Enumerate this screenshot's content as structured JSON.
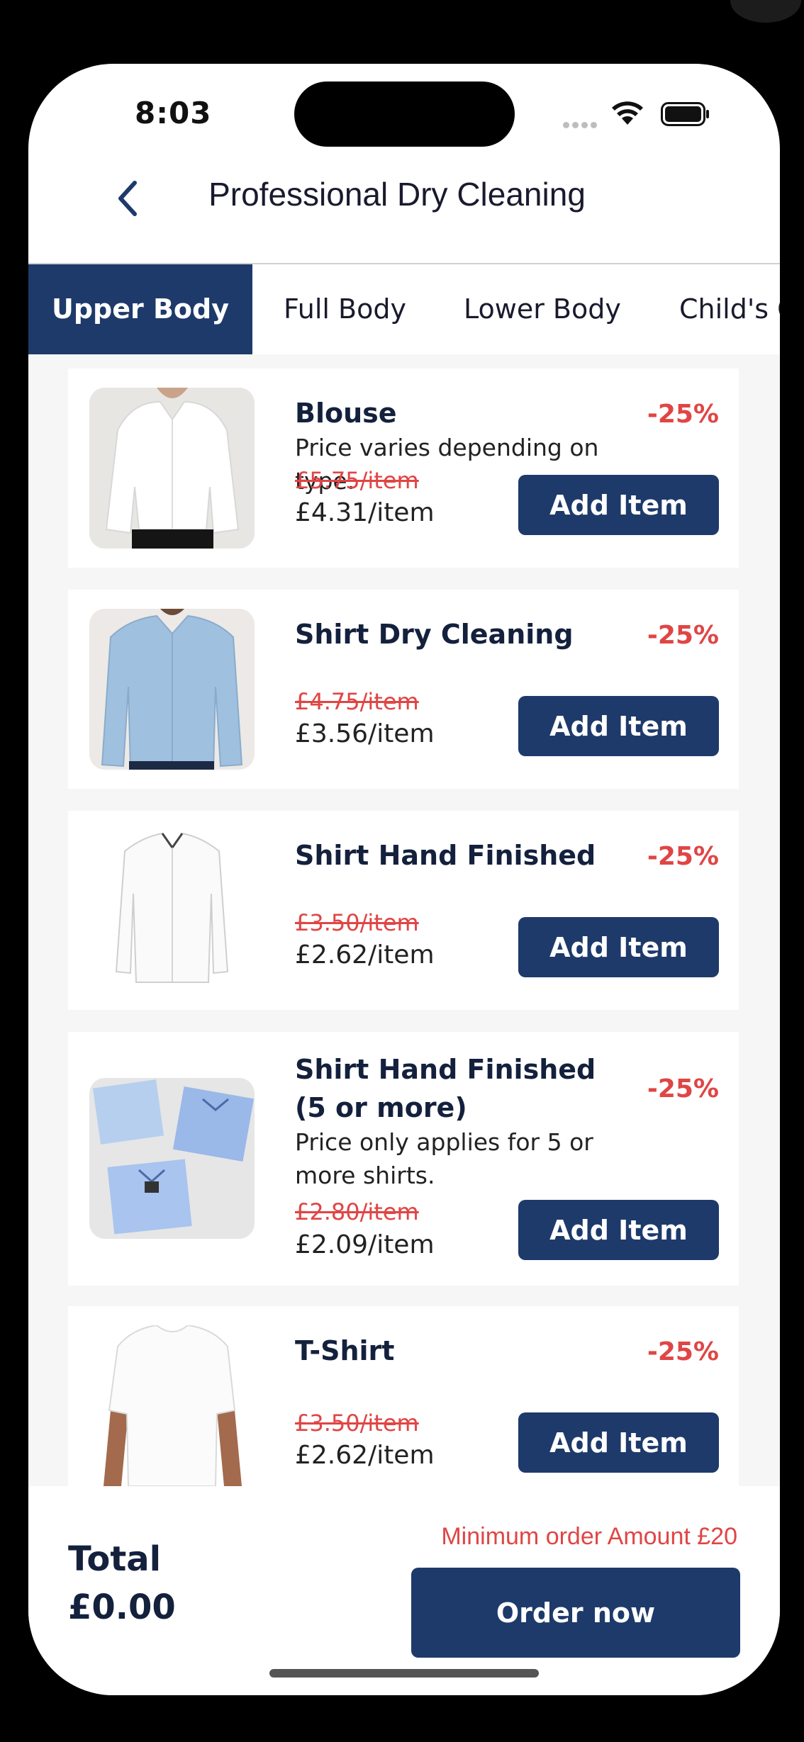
{
  "status": {
    "time": "8:03"
  },
  "header": {
    "title": "Professional Dry Cleaning"
  },
  "tabs": [
    {
      "label": "Upper Body"
    },
    {
      "label": "Full Body"
    },
    {
      "label": "Lower Body"
    },
    {
      "label": "Child's C"
    }
  ],
  "items": [
    {
      "name": "Blouse",
      "discount": "-25%",
      "description": "Price varies depending on type.",
      "old_price": "£5.75/item",
      "new_price": "£4.31/item",
      "button": "Add Item"
    },
    {
      "name": "Shirt Dry Cleaning",
      "discount": "-25%",
      "description": "",
      "old_price": "£4.75/item",
      "new_price": "£3.56/item",
      "button": "Add Item"
    },
    {
      "name": "Shirt Hand Finished",
      "discount": "-25%",
      "description": "",
      "old_price": "£3.50/item",
      "new_price": "£2.62/item",
      "button": "Add Item"
    },
    {
      "name": "Shirt Hand Finished (5 or more)",
      "discount": "-25%",
      "description": "Price only applies for 5 or more shirts.",
      "old_price": "£2.80/item",
      "new_price": "£2.09/item",
      "button": "Add Item"
    },
    {
      "name": "T-Shirt",
      "discount": "-25%",
      "description": "",
      "old_price": "£3.50/item",
      "new_price": "£2.62/item",
      "button": "Add Item"
    }
  ],
  "footer": {
    "total_label": "Total",
    "total_value": "£0.00",
    "minimum_note": "Minimum order Amount £20",
    "order_button": "Order now"
  },
  "colors": {
    "primary": "#1e3a6b",
    "discount": "#e04545",
    "background": "#f6f6f6"
  }
}
